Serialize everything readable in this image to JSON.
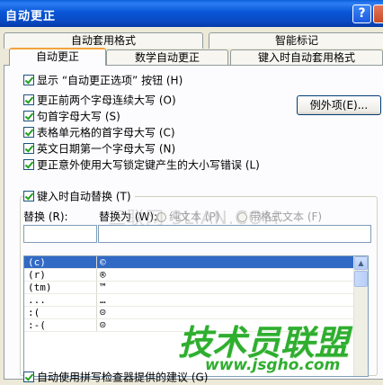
{
  "window": {
    "title": "自动更正"
  },
  "tabs_back": [
    {
      "label": "自动套用格式"
    },
    {
      "label": "智能标记"
    }
  ],
  "tabs_front": [
    {
      "label": "自动更正"
    },
    {
      "label": "数学自动更正"
    },
    {
      "label": "键入时自动套用格式"
    }
  ],
  "options": [
    {
      "label": "显示 “自动更正选项” 按钮 (H)",
      "checked": true
    },
    {
      "label": "更正前两个字母连续大写 (O)",
      "checked": true
    },
    {
      "label": "句首字母大写 (S)",
      "checked": true
    },
    {
      "label": "表格单元格的首字母大写 (C)",
      "checked": true
    },
    {
      "label": "英文日期第一个字母大写 (N)",
      "checked": true
    },
    {
      "label": "更正意外使用大写锁定键产生的大小写错误 (L)",
      "checked": true
    }
  ],
  "exceptions_button": "例外项(E)...",
  "replace_group": {
    "checkbox_label": "键入时自动替换 (T)",
    "replace_label": "替换 (R):",
    "with_label": "替换为 (W):",
    "plain_text": "纯文本 (P)",
    "formatted_text": "带格式文本 (F)",
    "replace_value": "",
    "with_value": ""
  },
  "entries": [
    {
      "key": "(c)",
      "value": "©"
    },
    {
      "key": "(r)",
      "value": "®"
    },
    {
      "key": "(tm)",
      "value": "™"
    },
    {
      "key": "...",
      "value": "…"
    },
    {
      "key": ":(",
      "value": "☹"
    },
    {
      "key": ":-(",
      "value": "☹"
    }
  ],
  "bottom_option": "自动使用拼写检查器提供的建议 (G)",
  "watermarks": {
    "top": "三联网 3LIAN.COM",
    "logo": "技术员联盟",
    "url": "www.jsgho.com"
  },
  "colors": {
    "titlebar": "#0a49c2",
    "selection": "#316ac5",
    "watermark": "#2fae2f"
  }
}
